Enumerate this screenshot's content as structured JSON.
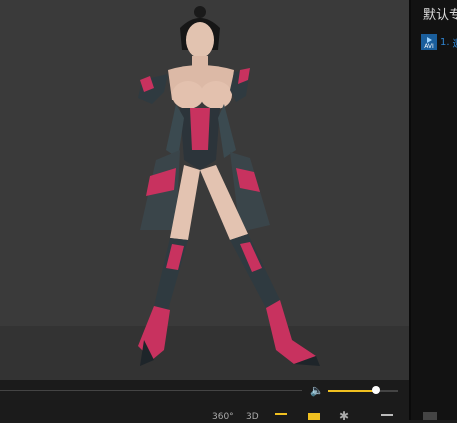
{
  "sidebar": {
    "title": "默认专",
    "playlist": [
      {
        "index_label": "1.",
        "text": "邀",
        "badge": "AVI"
      }
    ]
  },
  "player": {
    "volume": 0.68,
    "buttons": {
      "view360": "360°",
      "mode3d": "3D"
    }
  },
  "colors": {
    "accent": "#f0c020",
    "link": "#2f86d3"
  }
}
